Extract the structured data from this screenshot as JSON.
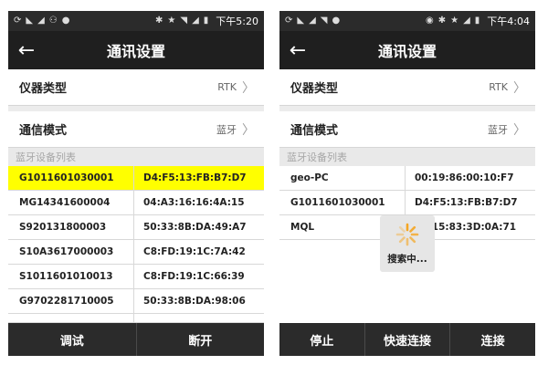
{
  "left": {
    "status": {
      "time": "下午5:20"
    },
    "appbar": {
      "title": "通讯设置"
    },
    "settings": [
      {
        "label": "仪器类型",
        "value": "RTK"
      },
      {
        "label": "通信模式",
        "value": "蓝牙"
      }
    ],
    "section_label": "蓝牙设备列表",
    "devices": [
      {
        "name": "G1011601030001",
        "mac": "D4:F5:13:FB:B7:D7",
        "selected": true
      },
      {
        "name": "MG14341600004",
        "mac": "04:A3:16:16:4A:15"
      },
      {
        "name": "S920131800003",
        "mac": "50:33:8B:DA:49:A7"
      },
      {
        "name": "S10A3617000003",
        "mac": "C8:FD:19:1C:7A:42"
      },
      {
        "name": "S1011601010013",
        "mac": "C8:FD:19:1C:66:39"
      },
      {
        "name": "G9702281710005",
        "mac": "50:33:8B:DA:98:06"
      }
    ],
    "buttons": [
      "调试",
      "断开"
    ]
  },
  "right": {
    "status": {
      "time": "下午4:04"
    },
    "appbar": {
      "title": "通讯设置"
    },
    "settings": [
      {
        "label": "仪器类型",
        "value": "RTK"
      },
      {
        "label": "通信模式",
        "value": "蓝牙"
      }
    ],
    "section_label": "蓝牙设备列表",
    "devices": [
      {
        "name": "geo-PC",
        "mac": "00:19:86:00:10:F7"
      },
      {
        "name": "G1011601030001",
        "mac": "D4:F5:13:FB:B7:D7"
      },
      {
        "name": "MQL",
        "mac": "00:15:83:3D:0A:71"
      }
    ],
    "loading_text": "搜索中...",
    "buttons": [
      "停止",
      "快速连接",
      "连接"
    ]
  },
  "colors": {
    "highlight": "#ffff00",
    "bar": "#2b2b2b",
    "appbar": "#1f1f1f",
    "spinner": "#f5a623"
  },
  "icons": [
    "back-arrow-icon",
    "chevron-right-icon",
    "bluetooth-icon",
    "star-icon",
    "wifi-icon",
    "signal-icon",
    "battery-icon",
    "location-icon",
    "spinner-icon"
  ]
}
